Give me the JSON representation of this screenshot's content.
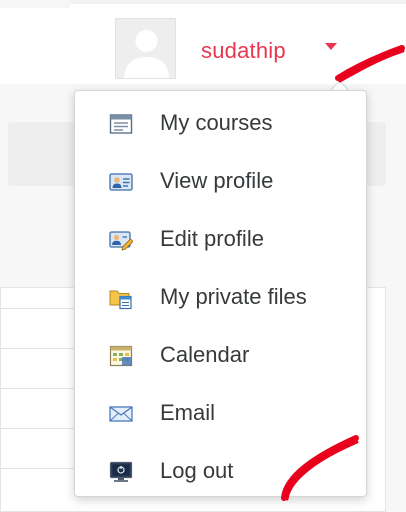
{
  "header": {
    "username": "sudathip"
  },
  "menu": {
    "items": [
      {
        "label": "My courses",
        "icon": "courses-icon"
      },
      {
        "label": "View profile",
        "icon": "profile-card-icon"
      },
      {
        "label": "Edit profile",
        "icon": "edit-profile-icon"
      },
      {
        "label": "My private files",
        "icon": "folder-files-icon"
      },
      {
        "label": "Calendar",
        "icon": "calendar-icon"
      },
      {
        "label": "Email",
        "icon": "envelope-icon"
      },
      {
        "label": "Log out",
        "icon": "logout-monitor-icon"
      }
    ]
  },
  "colors": {
    "accent": "#e8374f",
    "annotation": "#e8001c"
  }
}
